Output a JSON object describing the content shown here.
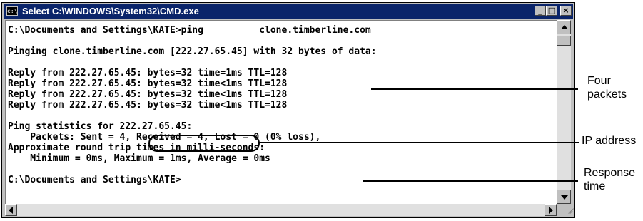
{
  "window": {
    "title": "Select C:\\WINDOWS\\System32\\CMD.exe",
    "icon_text": "c:\\",
    "buttons": {
      "minimize": "_",
      "maximize": "□",
      "close": "×"
    }
  },
  "console": {
    "lines": [
      "C:\\Documents and Settings\\KATE>ping          clone.timberline.com",
      "",
      "Pinging clone.timberline.com [222.27.65.45] with 32 bytes of data:",
      "",
      "Reply from 222.27.65.45: bytes=32 time=1ms TTL=128",
      "Reply from 222.27.65.45: bytes=32 time<1ms TTL=128",
      "Reply from 222.27.65.45: bytes=32 time<1ms TTL=128",
      "Reply from 222.27.65.45: bytes=32 time<1ms TTL=128",
      "",
      "Ping statistics for 222.27.65.45:",
      "    Packets: Sent = 4, Received = 4, Lost = 0 (0% loss),",
      "Approximate round trip times in milli-seconds:",
      "    Minimum = 0ms, Maximum = 1ms, Average = 0ms",
      "",
      "C:\\Documents and Settings\\KATE>"
    ]
  },
  "callouts": {
    "four_packets": "Four\npackets",
    "ip_address": "IP address",
    "response_time": "Response\ntime"
  }
}
